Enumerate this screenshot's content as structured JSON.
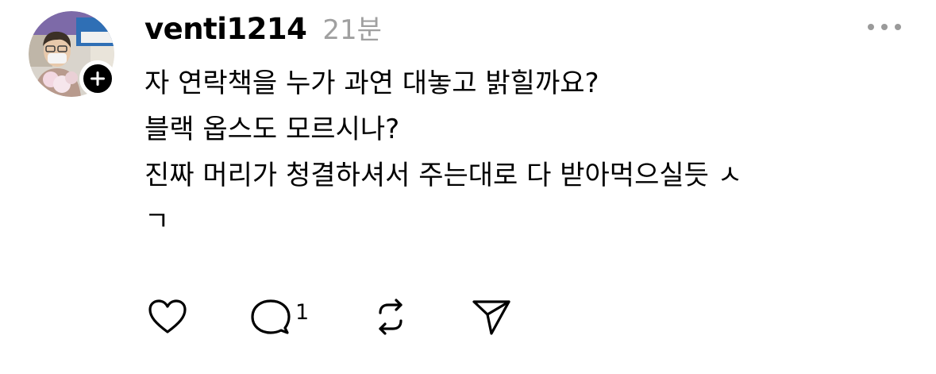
{
  "post": {
    "username": "venti1214",
    "time": "21분",
    "body_lines": [
      "자 연락책을 누가 과연 대놓고 밝힐까요?",
      "블랙 옵스도 모르시나?",
      "진짜 머리가 청결하셔서 주는대로 다 받아먹으실듯 ㅅ",
      "ㄱ"
    ],
    "reply_count": "1"
  },
  "icons": {
    "avatar": "avatar-photo",
    "follow": "plus-icon",
    "more": "more-dots-icon",
    "like": "heart-icon",
    "reply": "comment-bubble-icon",
    "repost": "repost-icon",
    "share": "send-icon"
  }
}
